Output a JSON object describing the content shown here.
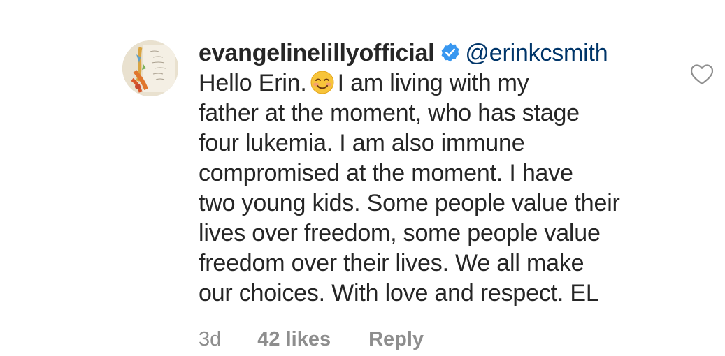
{
  "comment": {
    "username": "evangelinelillyofficial",
    "verified": true,
    "mention": "@erinkcsmith",
    "lines": [
      "Hello Erin.",
      "I am living with my",
      "father at the moment, who has stage",
      "four lukemia.  I am also immune",
      "compromised at the moment.  I have",
      "two young kids.  Some people value their",
      "lives over freedom, some people value",
      "freedom over their lives.  We all make",
      "our choices.  With love and respect.  EL"
    ],
    "emoji": "smiling-face-emoji",
    "timestamp": "3d",
    "likes": "42 likes",
    "reply_label": "Reply"
  },
  "icons": {
    "verified": "verified-badge-icon",
    "like": "heart-outline-icon"
  },
  "colors": {
    "text": "#262626",
    "mention": "#003569",
    "meta": "#8e8e8e",
    "verified_blue": "#3897f0",
    "background": "#ffffff"
  }
}
